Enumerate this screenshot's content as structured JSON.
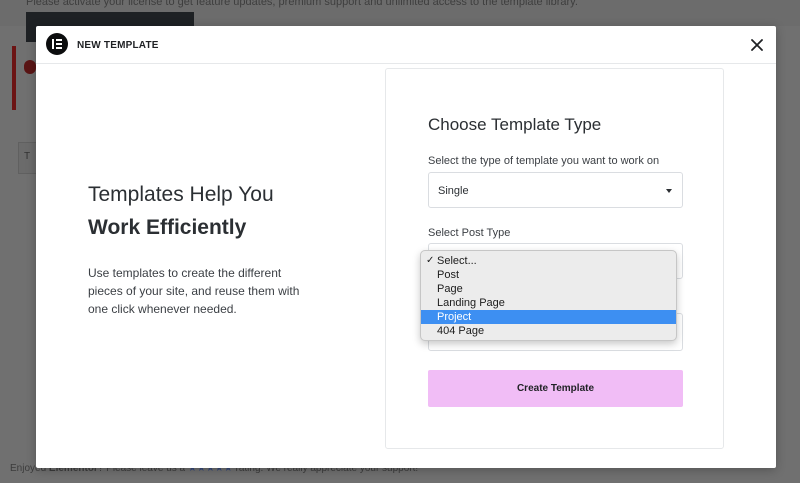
{
  "background": {
    "notice_text": "Please activate your license to get feature updates, premium support and unlimited access to the template library.",
    "tab_letter": "T",
    "footer_prefix": "Enjoyed ",
    "footer_brand": "Elementor",
    "footer_mid": "? Please leave us a ",
    "footer_stars": "★★★★★",
    "footer_suffix": " rating. We really appreciate your support!"
  },
  "modal": {
    "title": "NEW TEMPLATE",
    "close_icon": "close-icon",
    "logo_icon": "elementor-logo-icon"
  },
  "intro": {
    "heading_line1": "Templates Help You",
    "heading_line2": "Work Efficiently",
    "body": "Use templates to create the different pieces of your site, and reuse them with one click whenever needed."
  },
  "form": {
    "title": "Choose Template Type",
    "type_label": "Select the type of template you want to work on",
    "type_value": "Single",
    "post_type_label": "Select Post Type",
    "post_type_options": [
      "Select...",
      "Post",
      "Page",
      "Landing Page",
      "Project",
      "404 Page"
    ],
    "post_type_checked": "Select...",
    "post_type_highlighted": "Project",
    "create_label": "Create Template"
  },
  "colors": {
    "accent_button": "#f1bdf6",
    "highlight": "#3d8ff2",
    "overlay": "#707070"
  }
}
